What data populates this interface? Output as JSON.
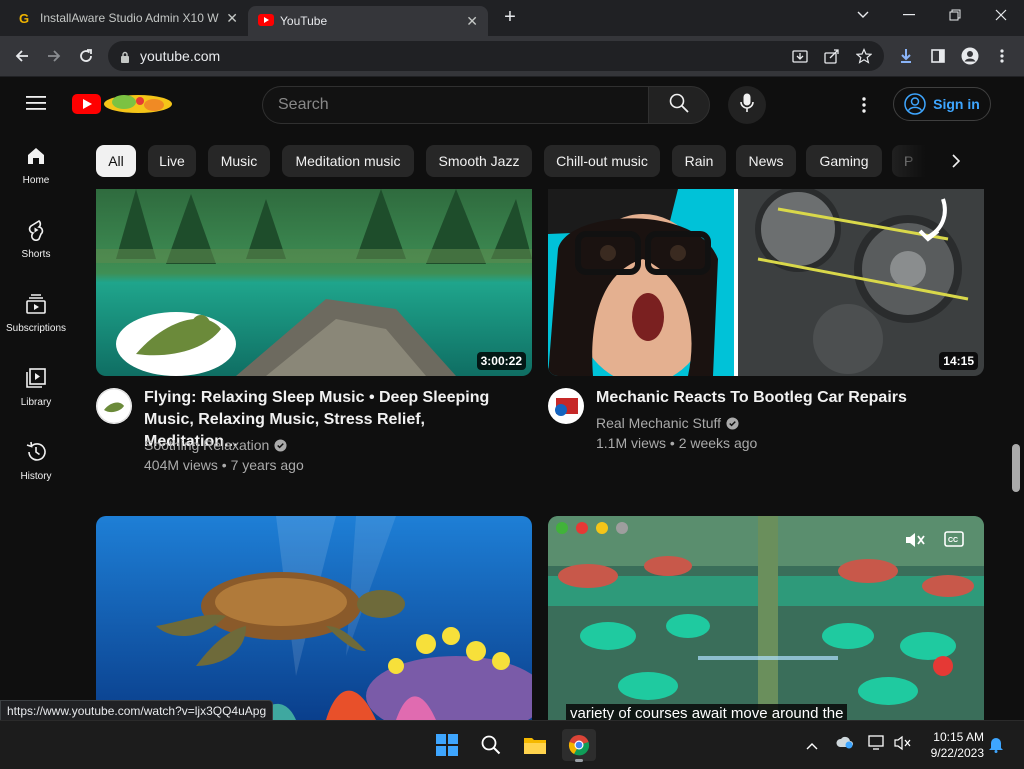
{
  "browser": {
    "tabs": [
      {
        "title": "InstallAware Studio Admin X10 W",
        "active": false
      },
      {
        "title": "YouTube",
        "active": true
      }
    ],
    "new_tab": "+",
    "url": "youtube.com"
  },
  "youtube": {
    "search_placeholder": "Search",
    "signin_label": "Sign in",
    "sidebar": [
      {
        "label": "Home",
        "icon": "home-icon"
      },
      {
        "label": "Shorts",
        "icon": "shorts-icon"
      },
      {
        "label": "Subscriptions",
        "icon": "subscriptions-icon"
      },
      {
        "label": "Library",
        "icon": "library-icon"
      },
      {
        "label": "History",
        "icon": "history-icon"
      }
    ],
    "chips": [
      "All",
      "Live",
      "Music",
      "Meditation music",
      "Smooth Jazz",
      "Chill-out music",
      "Rain",
      "News",
      "Gaming",
      "P"
    ],
    "videos": [
      {
        "title_line1": "Flying: Relaxing Sleep Music • Deep Sleeping",
        "title_line2": "Music, Relaxing Music, Stress Relief, Meditation...",
        "channel": "Soothing Relaxation",
        "meta": "404M views • 7 years ago",
        "duration": "3:00:22"
      },
      {
        "title_line1": "Mechanic Reacts To Bootleg Car Repairs",
        "title_line2": "",
        "channel": "Real Mechanic Stuff",
        "meta": "1.1M views • 2 weeks ago",
        "duration": "14:15"
      },
      {
        "caption": ""
      },
      {
        "caption": "variety of courses await move around the"
      }
    ]
  },
  "status_url": "https://www.youtube.com/watch?v=ljx3QQ4uApg",
  "taskbar": {
    "time": "10:15 AM",
    "date": "9/22/2023"
  },
  "colors": {
    "yt_red": "#ff0000",
    "link_blue": "#3ea6ff",
    "bg": "#0f0f0f"
  }
}
